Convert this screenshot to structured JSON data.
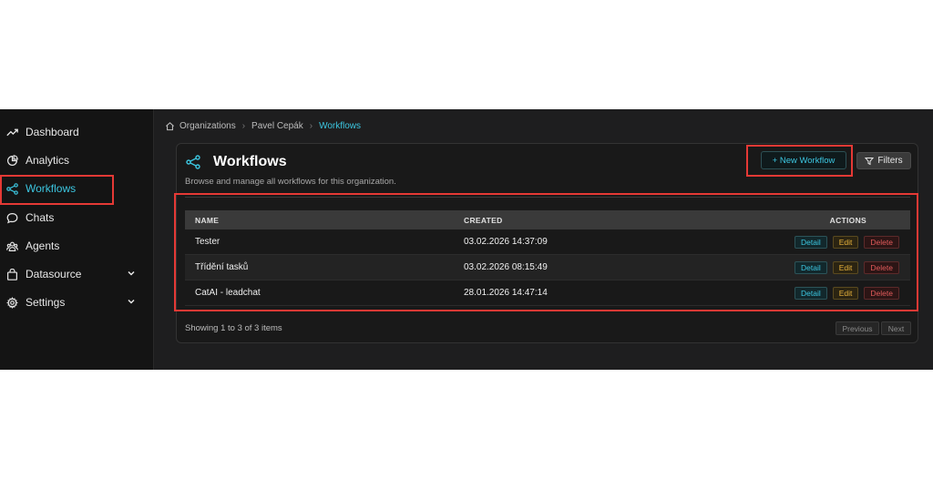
{
  "sidebar": {
    "items": [
      {
        "label": "Dashboard",
        "icon": "trend-up-icon"
      },
      {
        "label": "Analytics",
        "icon": "pie-chart-icon"
      },
      {
        "label": "Workflows",
        "icon": "share-nodes-icon",
        "active": true
      },
      {
        "label": "Chats",
        "icon": "chat-bubble-icon"
      },
      {
        "label": "Agents",
        "icon": "users-icon"
      },
      {
        "label": "Datasource",
        "icon": "bag-icon",
        "expandable": true
      },
      {
        "label": "Settings",
        "icon": "gear-icon",
        "expandable": true
      }
    ]
  },
  "breadcrumb": [
    "Organizations",
    "Pavel Cepák",
    "Workflows"
  ],
  "page": {
    "title": "Workflows",
    "subtitle": "Browse and manage all workflows for this organization.",
    "new_button": "+ New Workflow",
    "filters_button": "Filters"
  },
  "table": {
    "columns": [
      "NAME",
      "CREATED",
      "ACTIONS"
    ],
    "rows": [
      {
        "name": "Tester",
        "created": "03.02.2026 14:37:09"
      },
      {
        "name": "Třídění tasků",
        "created": "03.02.2026 08:15:49"
      },
      {
        "name": "CatAI - leadchat",
        "created": "28.01.2026 14:47:14"
      }
    ],
    "actions": {
      "detail": "Detail",
      "edit": "Edit",
      "delete": "Delete"
    }
  },
  "footer": {
    "summary": "Showing 1 to 3 of 3 items",
    "prev": "Previous",
    "next": "Next"
  },
  "colors": {
    "accent": "#3cc6e0",
    "annotation": "#e53935",
    "edit": "#e8b23c",
    "delete": "#e05a5a"
  }
}
